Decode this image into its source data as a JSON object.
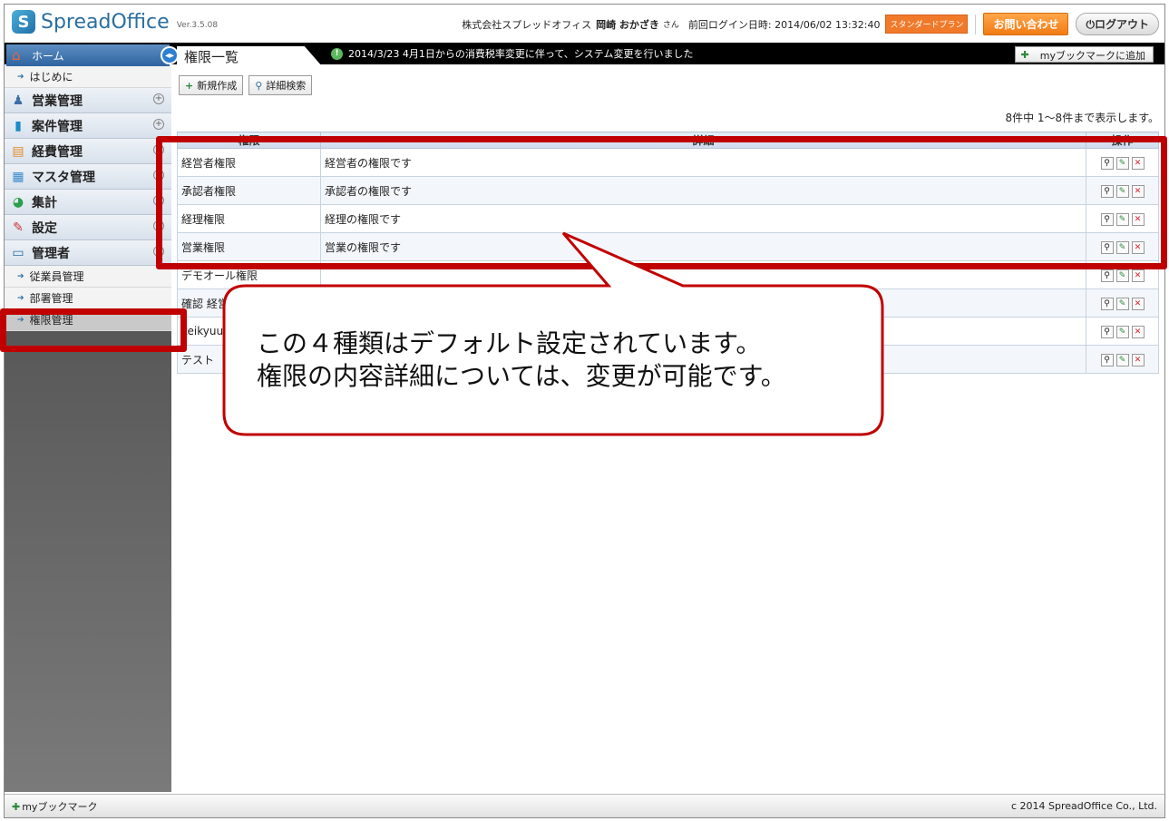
{
  "header": {
    "logo_text": "SpreadOffice",
    "version": "Ver.3.5.08",
    "company": "株式会社スプレッドオフィス",
    "user_name": "岡崎 おかざき",
    "honorific": "さん",
    "last_login": "前回ログイン日時: 2014/06/02 13:32:40",
    "plan": "スタンダードプラン",
    "contact_label": "お問い合わせ",
    "logout_label": "ログアウト"
  },
  "topbar": {
    "home_label": "ホーム",
    "page_title": "権限一覧",
    "notice": "2014/3/23 4月1日からの消費税率変更に伴って、システム変更を行いました",
    "bookmark_add": "myブックマークに追加"
  },
  "sidebar": {
    "intro": "はじめに",
    "sales": "営業管理",
    "projects": "案件管理",
    "expenses": "経費管理",
    "master": "マスタ管理",
    "aggregate": "集計",
    "settings": "設定",
    "admin": "管理者",
    "employees": "従業員管理",
    "departments": "部署管理",
    "permissions": "権限管理"
  },
  "toolbar": {
    "new_label": "新規作成",
    "search_label": "詳細検索"
  },
  "count_text": "8件中 1～8件まで表示します。",
  "table": {
    "headers": [
      "権限",
      "詳細",
      "操作"
    ],
    "rows": [
      {
        "name": "経営者権限",
        "detail": "経営者の権限です"
      },
      {
        "name": "承認者権限",
        "detail": "承認者の権限です"
      },
      {
        "name": "経理権限",
        "detail": "経理の権限です"
      },
      {
        "name": "営業権限",
        "detail": "営業の権限です"
      },
      {
        "name": "デモオール権限",
        "detail": ""
      },
      {
        "name": "確認 経営",
        "detail": ""
      },
      {
        "name": "keikyuu",
        "detail": ""
      },
      {
        "name": "テスト",
        "detail": ""
      }
    ]
  },
  "footer": {
    "bookmark": "myブックマーク",
    "copyright": "c 2014 SpreadOffice Co., Ltd."
  },
  "annotation": {
    "line1": "この４種類はデフォルト設定されています。",
    "line2": "権限の内容詳細については、変更が可能です。",
    "color": "#c00000"
  }
}
